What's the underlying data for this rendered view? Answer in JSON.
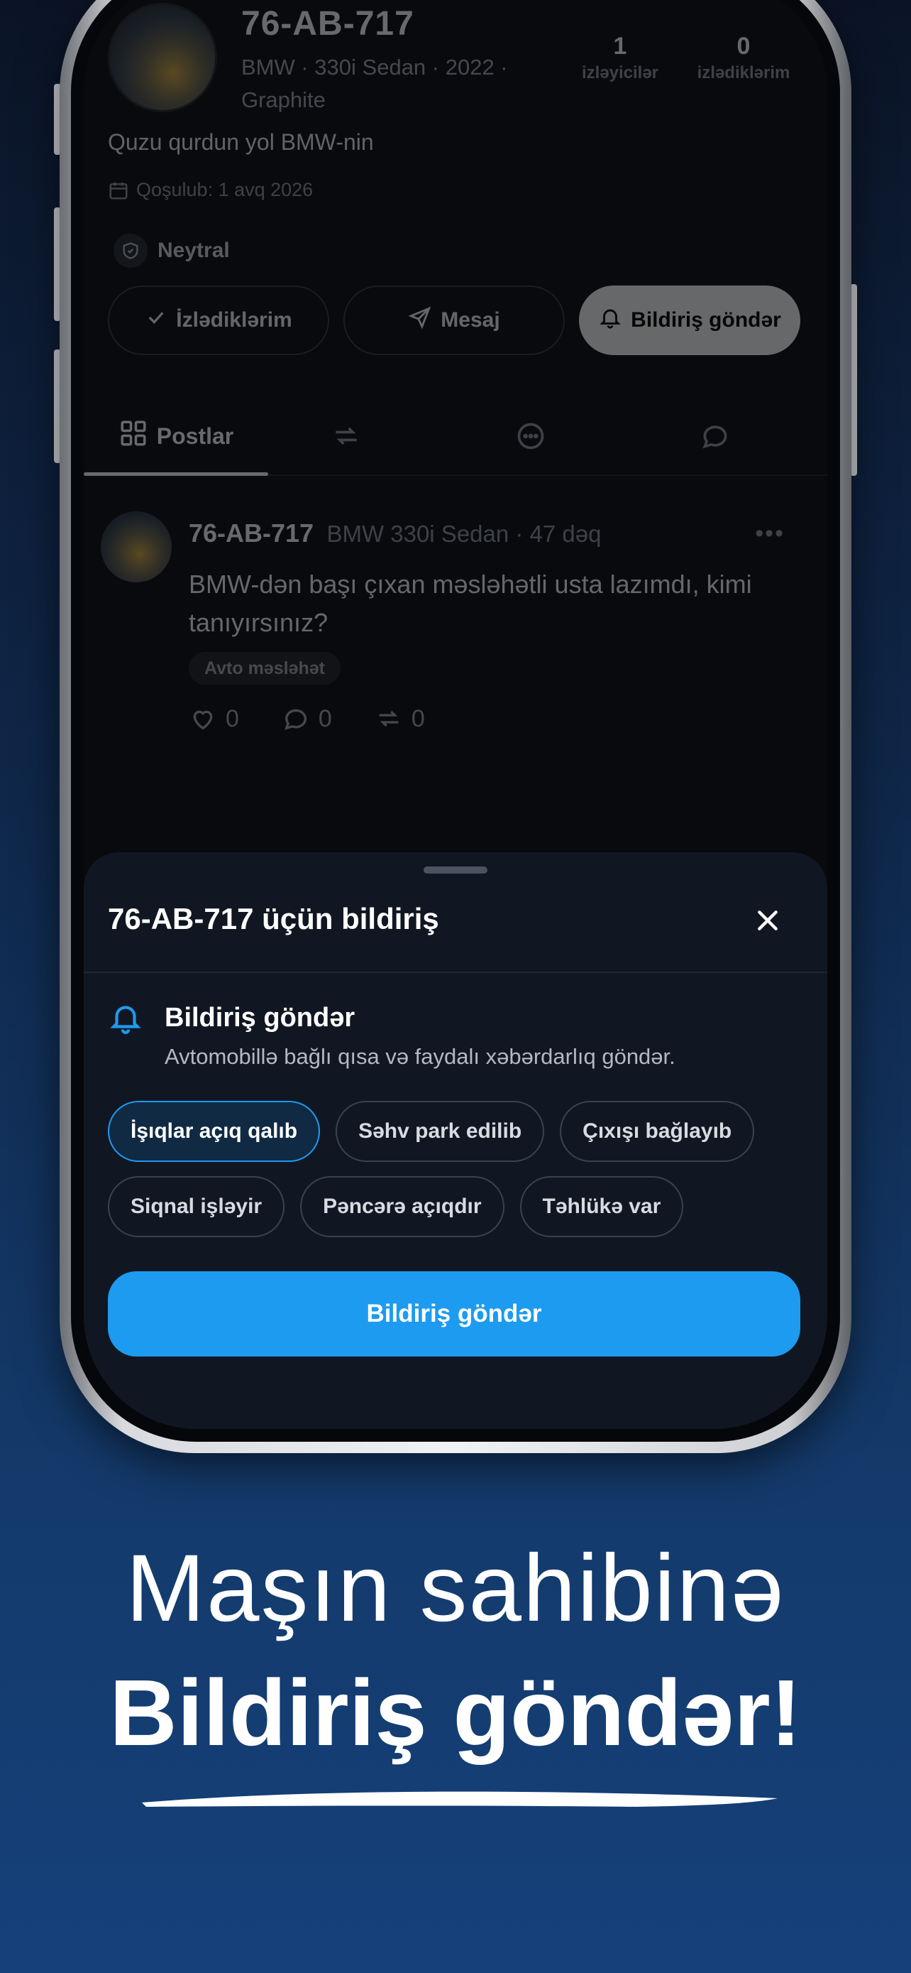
{
  "profile": {
    "plate": "76-AB-717",
    "model_line1": "BMW · 330i Sedan · 2022 ·",
    "model_line2": "Graphite",
    "followers_count": "1",
    "followers_label": "izləyicilər",
    "following_count": "0",
    "following_label": "izlədiklərim",
    "bio": "Quzu qurdun yol BMW-nin",
    "joined": "Qoşulub: 1 avq 2026",
    "badge": "Neytral",
    "buttons": {
      "follow": "İzlədiklərim",
      "message": "Mesaj",
      "notify": "Bildiriş göndər"
    },
    "tabs": {
      "posts": "Postlar"
    }
  },
  "post": {
    "author": "76-AB-717",
    "meta": "BMW 330i Sedan · 47 dəq",
    "text": "BMW-dən başı çıxan məsləhətli usta lazımdı, kimi tanıyırsınız?",
    "tag": "Avto məsləhət",
    "likes": "0",
    "comments": "0",
    "reposts": "0"
  },
  "sheet": {
    "title": "76-AB-717 üçün bildiriş",
    "section_title": "Bildiriş göndər",
    "section_desc": "Avtomobillə bağlı qısa və faydalı xəbərdarlıq göndər.",
    "chips": [
      "İşıqlar açıq qalıb",
      "Səhv park edilib",
      "Çıxışı bağlayıb",
      "Siqnal işləyir",
      "Pəncərə açıqdır",
      "Təhlükə var"
    ],
    "selected_chip": "İşıqlar açıq qalıb",
    "send_label": "Bildiriş göndər"
  },
  "marketing": {
    "line1": "Maşın sahibinə",
    "line2": "Bildiriş göndər!"
  },
  "colors": {
    "accent": "#1d9bf0",
    "sheet_bg": "#111722",
    "background_top": "#0b1426",
    "background_bottom": "#15407a"
  }
}
